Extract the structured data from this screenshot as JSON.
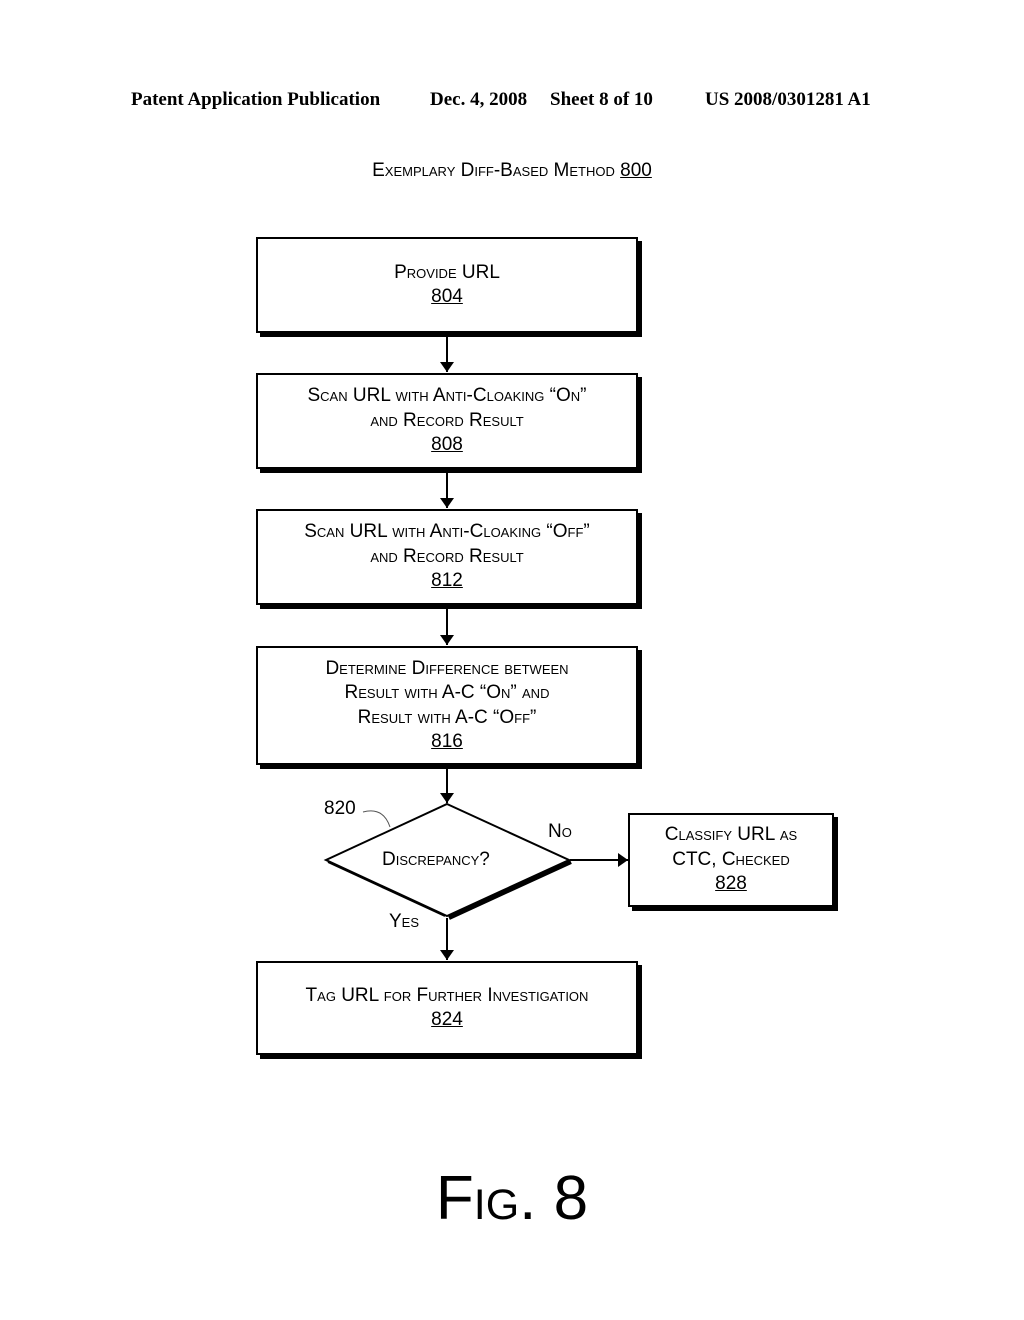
{
  "header": {
    "publication": "Patent Application Publication",
    "date": "Dec. 4, 2008",
    "sheet": "Sheet 8 of 10",
    "patent_number": "US 2008/0301281 A1"
  },
  "title": {
    "text": "Exemplary Diff-Based Method",
    "ref": "800"
  },
  "nodes": {
    "provide_url": {
      "lines": [
        "Provide URL"
      ],
      "ref": "804"
    },
    "scan_on": {
      "lines": [
        "Scan URL with Anti-Cloaking “On”",
        "and Record Result"
      ],
      "ref": "808"
    },
    "scan_off": {
      "lines": [
        "Scan URL with Anti-Cloaking “Off”",
        "and Record Result"
      ],
      "ref": "812"
    },
    "determine_diff": {
      "lines": [
        "Determine Difference between",
        "Result with A-C “On” and",
        "Result with A-C “Off”"
      ],
      "ref": "816"
    },
    "discrepancy": {
      "text": "Discrepancy?",
      "ref": "820"
    },
    "classify": {
      "lines": [
        "Classify URL as",
        "CTC, Checked"
      ],
      "ref": "828"
    },
    "tag": {
      "lines": [
        "Tag URL for Further Investigation"
      ],
      "ref": "824"
    }
  },
  "edges": {
    "no_label": "No",
    "yes_label": "Yes"
  },
  "figure_label": "Fig. 8"
}
